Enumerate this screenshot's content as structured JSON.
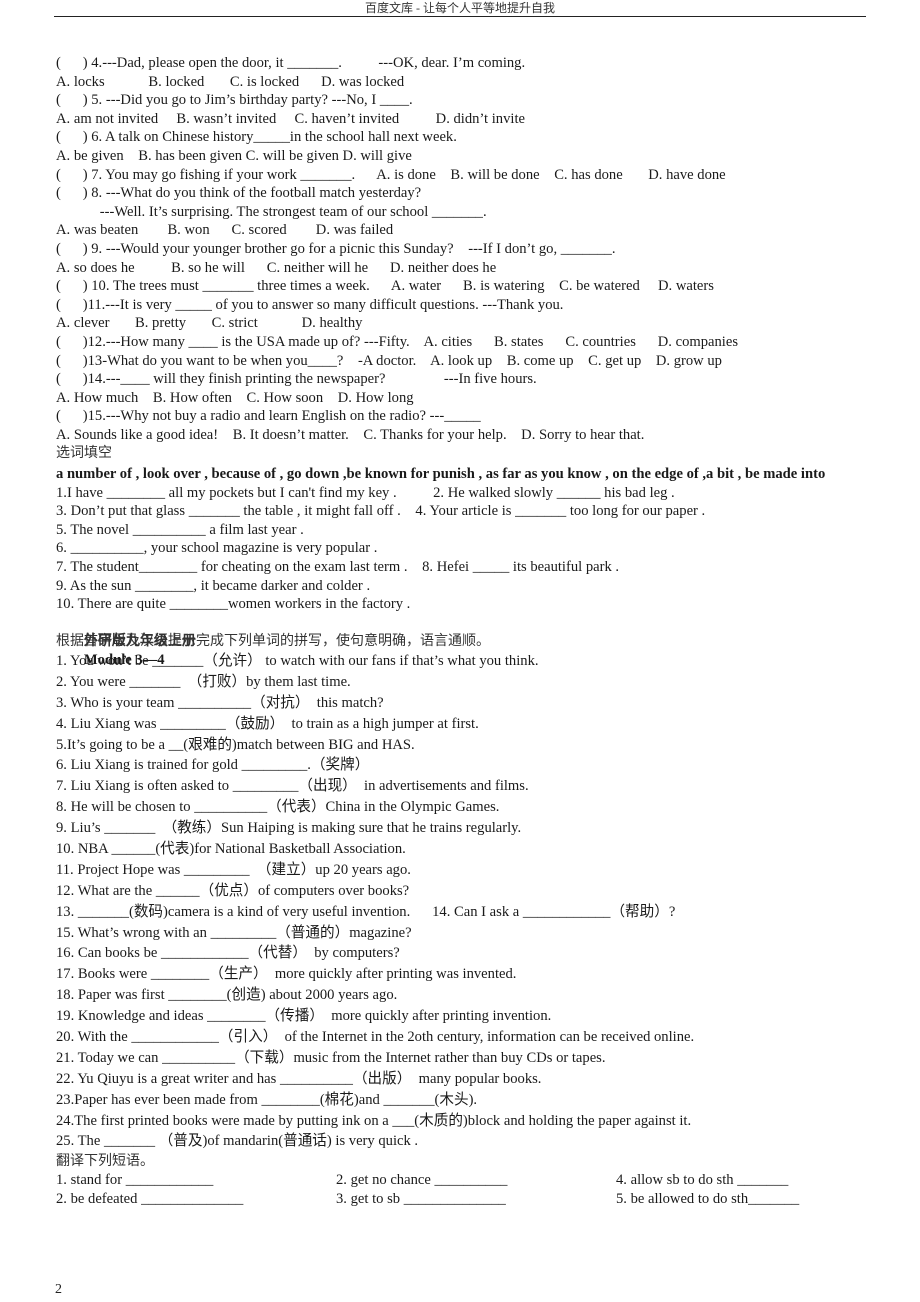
{
  "header": {
    "title": "百度文库 - 让每个人平等地提升自我"
  },
  "choice_questions": [
    {
      "stem": "(      ) 4.---Dad, please open the door, it _______.          ---OK, dear. I’m coming."
    },
    {
      "stem": "A. locks            B. locked       C. is locked      D. was locked"
    },
    {
      "stem": "(      ) 5. ---Did you go to Jim’s birthday party? ---No, I ____."
    },
    {
      "stem": "A. am not invited     B. wasn’t invited     C. haven’t invited          D. didn’t invite"
    },
    {
      "stem": "(      ) 6. A talk on Chinese history_____in the school hall next week."
    },
    {
      "stem": "A. be given    B. has been given C. will be given D. will give"
    },
    {
      "stem": "(      ) 7. You may go fishing if your work _______.      A. is done    B. will be done    C. has done       D. have done"
    },
    {
      "stem": "(      ) 8. ---What do you think of the football match yesterday?"
    },
    {
      "stem": "            ---Well. It’s surprising. The strongest team of our school _______."
    },
    {
      "stem": "A. was beaten        B. won      C. scored        D. was failed"
    },
    {
      "stem": "(      ) 9. ---Would your younger brother go for a picnic this Sunday?    ---If I don’t go, _______."
    },
    {
      "stem": "A. so does he          B. so he will      C. neither will he      D. neither does he"
    },
    {
      "stem": "(      ) 10. The trees must _______ three times a week.      A. water      B. is watering    C. be watered     D. waters"
    },
    {
      "stem": "(      )11.---It is very _____ of you to answer so many difficult questions. ---Thank you."
    },
    {
      "stem": "A. clever       B. pretty       C. strict            D. healthy"
    },
    {
      "stem": "(      )12.---How many ____ is the USA made up of? ---Fifty.    A. cities      B. states      C. countries      D. companies"
    },
    {
      "stem": "(      )13-What do you want to be when you____?    -A doctor.    A. look up    B. come up    C. get up    D. grow up"
    },
    {
      "stem": "(      )14.---____ will they finish printing the newspaper?                ---In five hours."
    },
    {
      "stem": "A. How much    B. How often    C. How soon    D. How long"
    },
    {
      "stem": "(      )15.---Why not buy a radio and learn English on the radio? ---_____"
    },
    {
      "stem": "A. Sounds like a good idea!    B. It doesn’t matter.    C. Thanks for your help.    D. Sorry to hear that."
    }
  ],
  "word_fill": {
    "heading": "选词填空",
    "word_bank": "a number of , look over , because of , go down ,be known for punish , as far as you know , on the edge of ,a bit , be made into",
    "items": [
      "1.I have ________ all my pockets but I can't find my key .          2. He walked slowly ______ his bad leg .",
      "3. Don’t put that glass _______ the table , it might fall off .    4. Your article is _______ too long for our paper .",
      "5. The novel __________ a film last year .",
      "6. __________, your school magazine is very popular .",
      "7. The student________ for cheating on the exam last term .    8. Hefei _____ its beautiful park .",
      "9. As the sun ________, it became darker and colder .",
      "10. There are quite ________women workers in the factory ."
    ]
  },
  "module_section": {
    "title_cn": "外研版九年级上册",
    "title_en": "Module 3—4",
    "instruction": "根据首字母及汉语提示完成下列单词的拼写，使句意明确，语言通顺。",
    "items": [
      "1. You won’t be _______（允许） to watch with our fans if that’s what you think.",
      "2. You were _______  （打败）by them last time.",
      "3. Who is your team __________（对抗）  this match?",
      "4. Liu Xiang was _________（鼓励）  to train as a high jumper at first.",
      "5.It’s going to be a __(艰难的)match between BIG and HAS.",
      "6. Liu Xiang is trained for gold _________.（奖牌）",
      "7. Liu Xiang is often asked to _________（出现）  in advertisements and films.",
      "8. He will be chosen to __________（代表）China in the Olympic Games.",
      "9. Liu’s _______  （教练）Sun Haiping is making sure that he trains regularly.",
      "10. NBA ______(代表)for National Basketball Association.",
      "11. Project Hope was _________  （建立）up 20 years ago.",
      "12. What are the ______（优点）of computers over books?",
      "13. _______(数码)camera is a kind of very useful invention.      14. Can I ask a ____________（帮助）?",
      "15. What’s wrong with an _________（普通的）magazine?",
      "16. Can books be ____________（代替）  by computers?",
      "17. Books were ________（生产）  more quickly after printing was invented.",
      "18. Paper was first ________(创造) about 2000 years ago.",
      "19. Knowledge and ideas ________（传播）  more quickly after printing invention.",
      "20. With the ____________（引入）  of the Internet in the 2oth century, information can be received online.",
      "21. Today we can __________（下载）music from the Internet rather than buy CDs or tapes.",
      "22. Yu Qiuyu is a great writer and has __________（出版）  many popular books.",
      "23.Paper has ever been made from ________(棉花)and _______(木头).",
      "24.The first printed books were made by putting ink on a ___(木质的)block and holding the paper against it.",
      "25. The _______ （普及)of mandarin(普通话) is very quick ."
    ]
  },
  "translation": {
    "heading": "翻译下列短语。",
    "rows": [
      [
        "1. stand for ____________",
        "2. get no chance __________",
        "4. allow sb to do sth _______"
      ],
      [
        "2. be defeated ______________",
        "3. get to sb ______________",
        "5. be allowed to do sth_______"
      ]
    ]
  },
  "footer": {
    "page_number": "2"
  }
}
